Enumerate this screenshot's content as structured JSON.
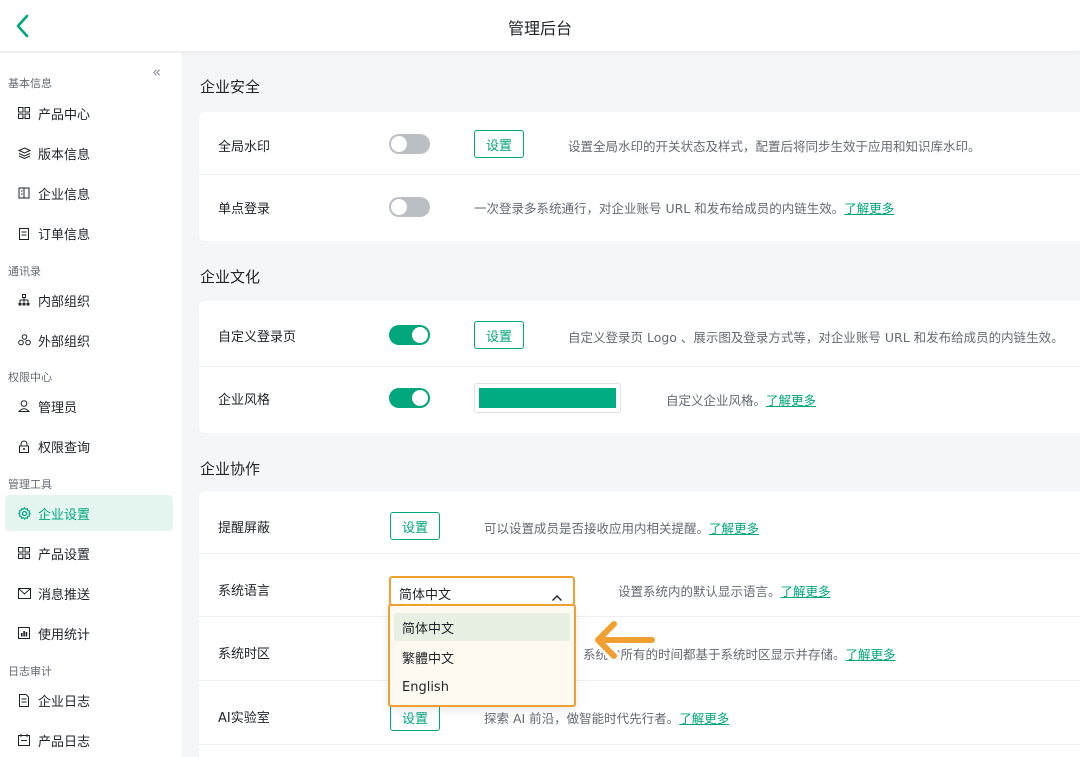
{
  "header": {
    "title": "管理后台"
  },
  "sidebar": {
    "collapse_label": "«",
    "groups": [
      {
        "title": "基本信息",
        "items": [
          {
            "label": "产品中心",
            "icon": "grid-icon"
          },
          {
            "label": "版本信息",
            "icon": "layers-icon"
          },
          {
            "label": "企业信息",
            "icon": "building-icon"
          },
          {
            "label": "订单信息",
            "icon": "clipboard-icon"
          }
        ]
      },
      {
        "title": "通讯录",
        "items": [
          {
            "label": "内部组织",
            "icon": "org-tree-icon"
          },
          {
            "label": "外部组织",
            "icon": "people-icon"
          }
        ]
      },
      {
        "title": "权限中心",
        "items": [
          {
            "label": "管理员",
            "icon": "user-icon"
          },
          {
            "label": "权限查询",
            "icon": "lock-icon"
          }
        ]
      },
      {
        "title": "管理工具",
        "items": [
          {
            "label": "企业设置",
            "icon": "settings-icon",
            "active": true
          },
          {
            "label": "产品设置",
            "icon": "grid-icon"
          },
          {
            "label": "消息推送",
            "icon": "mail-icon"
          },
          {
            "label": "使用统计",
            "icon": "chart-icon"
          }
        ]
      },
      {
        "title": "日志审计",
        "items": [
          {
            "label": "企业日志",
            "icon": "log-icon"
          },
          {
            "label": "产品日志",
            "icon": "calendar-log-icon"
          }
        ]
      }
    ]
  },
  "sections": {
    "security": {
      "title": "企业安全",
      "watermark": {
        "name": "全局水印",
        "toggle": "off",
        "button": "设置",
        "desc": "设置全局水印的开关状态及样式，配置后将同步生效于应用和知识库水印。"
      },
      "sso": {
        "name": "单点登录",
        "toggle": "off",
        "desc": "一次登录多系统通行，对企业账号 URL 和发布给成员的内链生效。",
        "link": "了解更多"
      }
    },
    "culture": {
      "title": "企业文化",
      "login_page": {
        "name": "自定义登录页",
        "toggle": "on",
        "button": "设置",
        "desc": "自定义登录页 Logo 、展示图及登录方式等，对企业账号 URL 和发布给成员的内链生效。"
      },
      "style": {
        "name": "企业风格",
        "toggle": "on",
        "color": "#00ad82",
        "desc": "自定义企业风格。",
        "link": "了解更多"
      }
    },
    "collab": {
      "title": "企业协作",
      "reminder": {
        "name": "提醒屏蔽",
        "button": "设置",
        "desc": "可以设置成员是否接收应用内相关提醒。",
        "link": "了解更多"
      },
      "language": {
        "name": "系统语言",
        "selected": "简体中文",
        "desc": "设置系统内的默认显示语言。",
        "link": "了解更多",
        "options": [
          "简体中文",
          "繁體中文",
          "English"
        ]
      },
      "timezone": {
        "name": "系统时区",
        "desc": "系统内所有的时间都基于系统时区显示并存储。",
        "link": "了解更多"
      },
      "ai_lab": {
        "name": "AI实验室",
        "button": "设置",
        "desc": "探索 AI 前沿，做智能时代先行者。",
        "link": "了解更多"
      }
    }
  },
  "colors": {
    "accent": "#00a67c",
    "highlight": "#f0a030"
  }
}
